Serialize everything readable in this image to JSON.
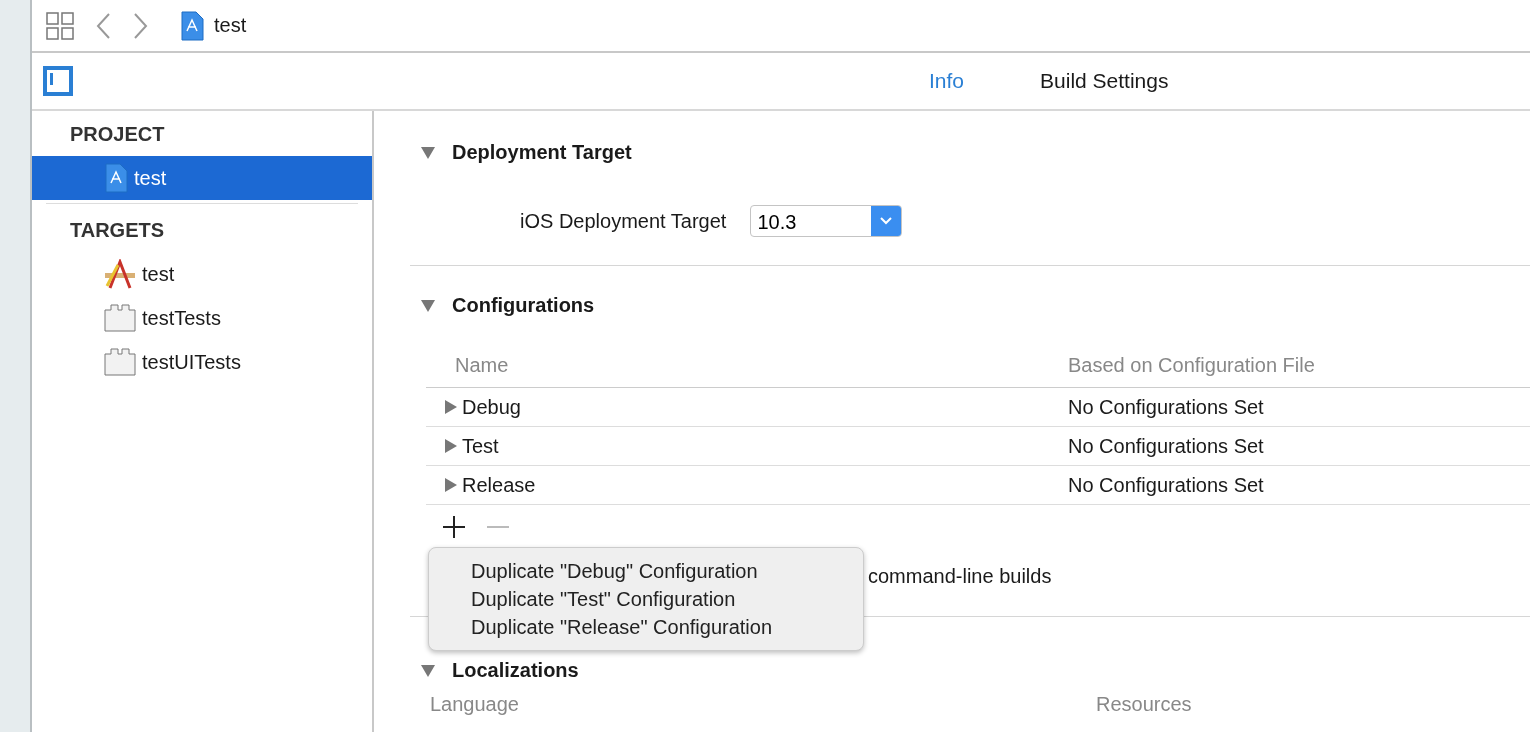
{
  "toolbar": {
    "breadcrumb": "test"
  },
  "tabs": [
    {
      "label": "Info",
      "selected": true
    },
    {
      "label": "Build Settings",
      "selected": false
    }
  ],
  "sidebar": {
    "sections": [
      {
        "title": "PROJECT",
        "items": [
          {
            "label": "test",
            "kind": "project",
            "selected": true
          }
        ]
      },
      {
        "title": "TARGETS",
        "items": [
          {
            "label": "test",
            "kind": "app",
            "selected": false
          },
          {
            "label": "testTests",
            "kind": "bundle",
            "selected": false
          },
          {
            "label": "testUITests",
            "kind": "bundle",
            "selected": false
          }
        ]
      }
    ]
  },
  "deployment": {
    "title": "Deployment Target",
    "expanded": true,
    "field_label": "iOS Deployment Target",
    "value": "10.3"
  },
  "configurations": {
    "title": "Configurations",
    "expanded": true,
    "columns": [
      "Name",
      "Based on Configuration File"
    ],
    "rows": [
      {
        "name": "Debug",
        "file": "No Configurations Set",
        "expanded": false
      },
      {
        "name": "Test",
        "file": "No Configurations Set",
        "expanded": false
      },
      {
        "name": "Release",
        "file": "No Configurations Set",
        "expanded": false
      }
    ],
    "note": "command-line builds"
  },
  "menu": {
    "items": [
      "Duplicate \"Debug\" Configuration",
      "Duplicate \"Test\" Configuration",
      "Duplicate \"Release\" Configuration"
    ]
  },
  "localizations": {
    "title": "Localizations",
    "expanded": true,
    "columns": [
      "Language",
      "Resources"
    ]
  }
}
